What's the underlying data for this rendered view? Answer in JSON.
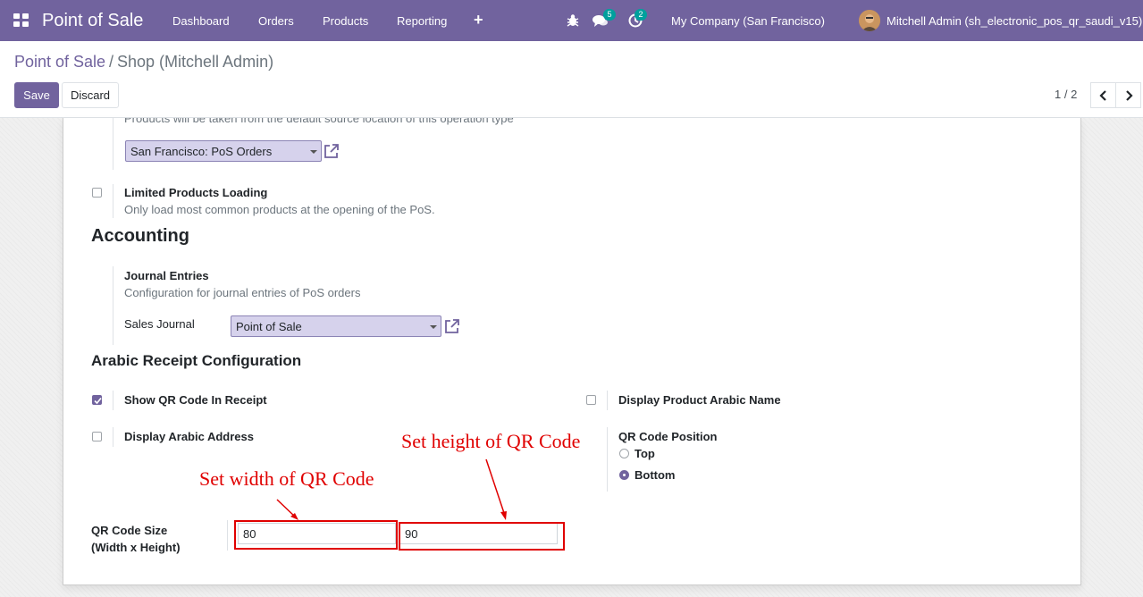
{
  "navbar": {
    "brand": "Point of Sale",
    "menu": [
      {
        "label": "Dashboard"
      },
      {
        "label": "Orders"
      },
      {
        "label": "Products"
      },
      {
        "label": "Reporting"
      }
    ],
    "messages_count": "5",
    "activities_count": "2",
    "company": "My Company (San Francisco)",
    "user": "Mitchell Admin (sh_electronic_pos_qr_saudi_v15)"
  },
  "breadcrumb": {
    "parent": "Point of Sale",
    "separator": "/",
    "current": "Shop (Mitchell Admin)"
  },
  "actions": {
    "save": "Save",
    "discard": "Discard"
  },
  "pager": {
    "value": "1 / 2"
  },
  "form": {
    "top_clipped_text": "Products will be taken from the default source location of this operation type",
    "operation_type_value": "San Francisco: PoS Orders",
    "limited_products": {
      "label": "Limited Products Loading",
      "description": "Only load most common products at the opening of the PoS.",
      "checked": false
    },
    "accounting": {
      "heading": "Accounting",
      "journal_entries_label": "Journal Entries",
      "journal_entries_description": "Configuration for journal entries of PoS orders",
      "sales_journal_label": "Sales Journal",
      "sales_journal_value": "Point of Sale"
    },
    "arabic_receipt": {
      "heading": "Arabic Receipt Configuration",
      "show_qr_label": "Show QR Code In Receipt",
      "show_qr_checked": true,
      "display_product_arabic_label": "Display Product Arabic Name",
      "display_product_arabic_checked": false,
      "display_arabic_address_label": "Display Arabic Address",
      "display_arabic_address_checked": false,
      "qr_position_label": "QR Code Position",
      "qr_position_options": [
        {
          "label": "Top",
          "selected": false
        },
        {
          "label": "Bottom",
          "selected": true
        }
      ],
      "qr_size_label_line1": "QR Code Size",
      "qr_size_label_line2": "(Width x Height)",
      "qr_width": "80",
      "qr_height": "90"
    }
  },
  "annotations": {
    "width": "Set width of QR Code",
    "height": "Set height of QR Code",
    "color": "#e00000"
  },
  "colors": {
    "brand": "#71639e",
    "badge": "#00a09d"
  }
}
